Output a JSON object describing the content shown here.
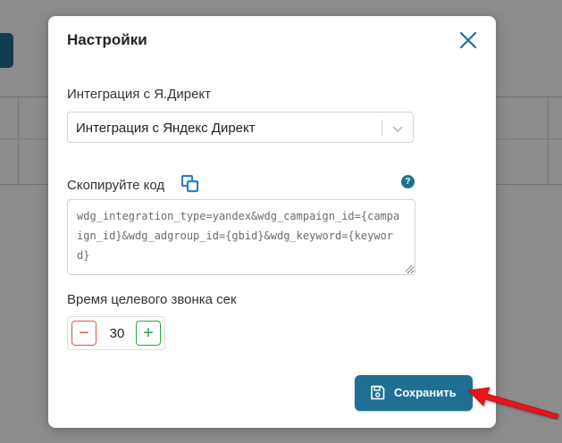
{
  "modal": {
    "title": "Настройки",
    "integration": {
      "label": "Интеграция с Я.Директ",
      "selected": "Интеграция с Яндекс Директ"
    },
    "copy_code": {
      "label": "Скопируйте код",
      "help_symbol": "?",
      "code": "wdg_integration_type=yandex&wdg_campaign_id={campaign_id}&wdg_adgroup_id={gbid}&wdg_keyword={keyword}"
    },
    "target_call": {
      "label": "Время целевого звонка сек",
      "value": "30",
      "minus_symbol": "−",
      "plus_symbol": "+"
    },
    "save_label": "Сохранить"
  },
  "colors": {
    "accent": "#1f6f94",
    "minus": "#d9534f",
    "plus": "#28a745",
    "arrow": "#e8141b"
  }
}
